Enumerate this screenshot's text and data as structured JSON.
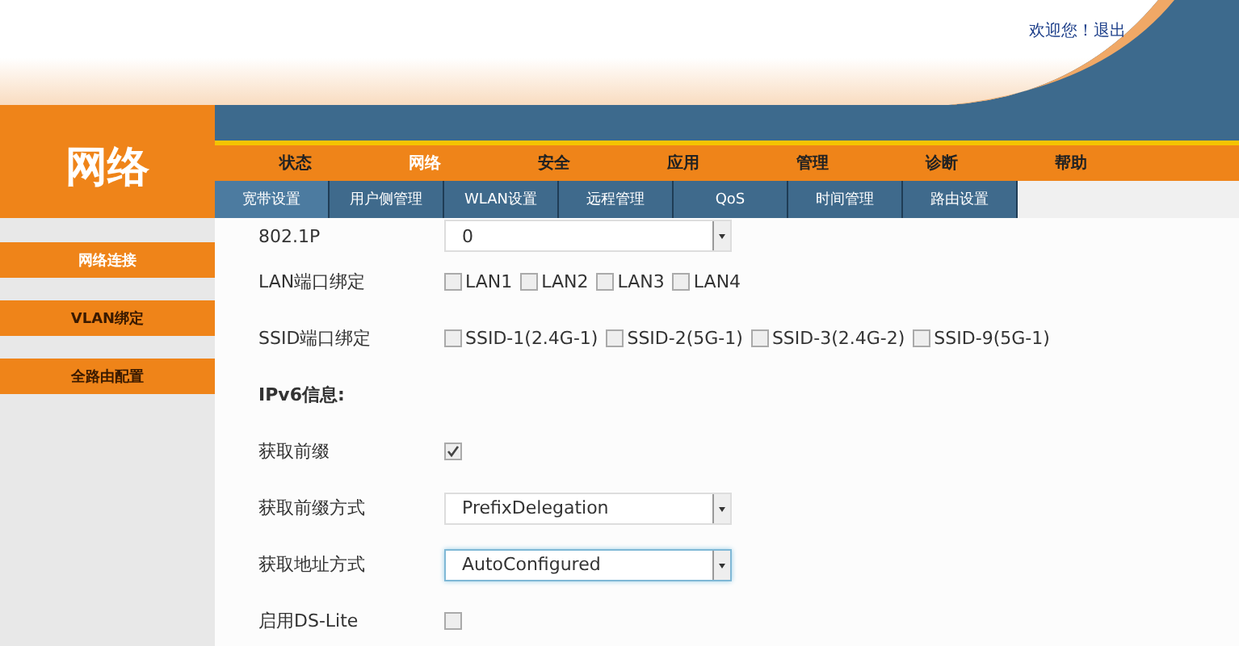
{
  "header": {
    "user_links": "欢迎您！退出"
  },
  "section_title": "网络",
  "nav": [
    {
      "label": "状态",
      "selected": false
    },
    {
      "label": "网络",
      "selected": true
    },
    {
      "label": "安全",
      "selected": false
    },
    {
      "label": "应用",
      "selected": false
    },
    {
      "label": "管理",
      "selected": false
    },
    {
      "label": "诊断",
      "selected": false
    },
    {
      "label": "帮助",
      "selected": false
    }
  ],
  "subnav": [
    {
      "label": "宽带设置",
      "selected": true
    },
    {
      "label": "用户侧管理",
      "selected": false
    },
    {
      "label": "WLAN设置",
      "selected": false
    },
    {
      "label": "远程管理",
      "selected": false
    },
    {
      "label": "QoS",
      "selected": false
    },
    {
      "label": "时间管理",
      "selected": false
    },
    {
      "label": "路由设置",
      "selected": false
    }
  ],
  "sidebar": [
    {
      "label": "网络连接",
      "selected": true
    },
    {
      "label": "VLAN绑定",
      "selected": false
    },
    {
      "label": "全路由配置",
      "selected": false
    }
  ],
  "form": [
    {
      "kind": "select",
      "label": "802.1P",
      "value": "0",
      "focused": false
    },
    {
      "kind": "checkboxes",
      "label": "LAN端口绑定",
      "options": [
        {
          "label": "LAN1",
          "checked": false
        },
        {
          "label": "LAN2",
          "checked": false
        },
        {
          "label": "LAN3",
          "checked": false
        },
        {
          "label": "LAN4",
          "checked": false
        }
      ]
    },
    {
      "kind": "checkboxes",
      "label": "SSID端口绑定",
      "options": [
        {
          "label": "SSID-1(2.4G-1)",
          "checked": false
        },
        {
          "label": "SSID-2(5G-1)",
          "checked": false
        },
        {
          "label": "SSID-3(2.4G-2)",
          "checked": false
        },
        {
          "label": "SSID-9(5G-1)",
          "checked": false
        }
      ]
    },
    {
      "kind": "heading",
      "label": "IPv6信息:"
    },
    {
      "kind": "checkbox",
      "label": "获取前缀",
      "checked": true
    },
    {
      "kind": "select",
      "label": "获取前缀方式",
      "value": "PrefixDelegation",
      "focused": false
    },
    {
      "kind": "select",
      "label": "获取地址方式",
      "value": "AutoConfigured",
      "focused": true
    },
    {
      "kind": "checkbox",
      "label": "启用DS-Lite",
      "checked": false
    }
  ]
}
